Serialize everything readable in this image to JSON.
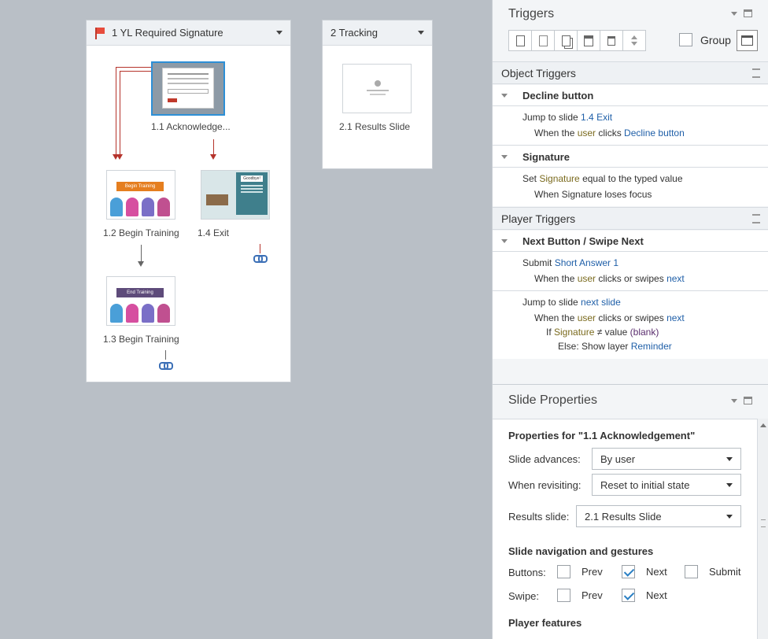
{
  "scenes": [
    {
      "title": "1 YL Required Signature",
      "slides": [
        {
          "label": "1.1 Acknowledge..."
        },
        {
          "label": "1.2 Begin Training",
          "thumb_text": "Begin Training"
        },
        {
          "label": "1.4 Exit",
          "thumb_text": "Goodbye!"
        },
        {
          "label": "1.3 Begin Training",
          "thumb_text": "End Training"
        }
      ]
    },
    {
      "title": "2 Tracking",
      "slides": [
        {
          "label": "2.1 Results Slide"
        }
      ]
    }
  ],
  "triggers": {
    "title": "Triggers",
    "group_label": "Group",
    "object_triggers_label": "Object Triggers",
    "player_triggers_label": "Player Triggers",
    "decline": {
      "title": "Decline button",
      "l1_a": "Jump to slide ",
      "l1_b": "1.4 Exit",
      "l2_a": "When the ",
      "l2_b": "user",
      "l2_c": " clicks ",
      "l2_d": "Decline button"
    },
    "signature": {
      "title": "Signature",
      "l1_a": "Set ",
      "l1_b": "Signature",
      "l1_c": " equal to the typed value",
      "l2": "When Signature loses focus"
    },
    "next": {
      "title": "Next Button / Swipe Next",
      "t1_a": "Submit ",
      "t1_b": "Short Answer 1",
      "t1w_a": "When the ",
      "t1w_b": "user",
      "t1w_c": " clicks or swipes ",
      "t1w_d": "next",
      "t2_a": "Jump to slide ",
      "t2_b": "next slide",
      "t2w_a": "When the ",
      "t2w_b": "user",
      "t2w_c": " clicks or swipes ",
      "t2w_d": "next",
      "cond_a": "If ",
      "cond_b": "Signature",
      "cond_c": " ≠ value ",
      "cond_d": "(blank)",
      "else_a": "Else: Show layer ",
      "else_b": "Reminder"
    }
  },
  "properties": {
    "title": "Slide Properties",
    "heading": "Properties for \"1.1 Acknowledgement\"",
    "advances_label": "Slide advances:",
    "advances_value": "By user",
    "revisit_label": "When revisiting:",
    "revisit_value": "Reset to initial state",
    "results_label": "Results slide:",
    "results_value": "2.1 Results Slide",
    "nav_heading": "Slide navigation and gestures",
    "buttons_label": "Buttons:",
    "swipe_label": "Swipe:",
    "prev": "Prev",
    "next": "Next",
    "submit": "Submit",
    "player_features": "Player features"
  }
}
